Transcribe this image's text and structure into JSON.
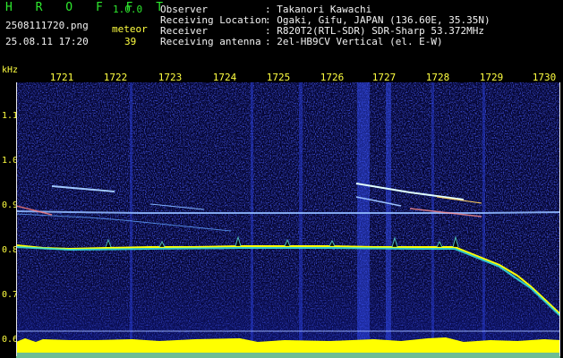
{
  "app": {
    "name": "H R O F F T",
    "version": "1.0.0"
  },
  "file": {
    "name": "2508111720.png",
    "datetime": "25.08.11 17:20"
  },
  "meteor": {
    "label": "meteor",
    "count": "39"
  },
  "info": [
    {
      "key": "Observer",
      "value": ": Takanori Kawachi"
    },
    {
      "key": "Receiving Location",
      "value": ": Ogaki, Gifu, JAPAN (136.60E, 35.35N)"
    },
    {
      "key": "Receiver",
      "value": ": R820T2(RTL-SDR) SDR-Sharp 53.372MHz"
    },
    {
      "key": "Receiving antenna",
      "value": ": 2el-HB9CV Vertical (el. E-W)"
    }
  ],
  "time_axis": [
    "1721",
    "1722",
    "1723",
    "1724",
    "1725",
    "1726",
    "1727",
    "1728",
    "1729",
    "1730"
  ],
  "freq_axis": {
    "unit": "kHz",
    "labels": [
      "1.1",
      "1.0",
      "0.9",
      "0.8",
      "0.7",
      "0.6"
    ]
  },
  "colors": {
    "header_green": "#2ee82e",
    "tick_yellow": "#ffff40",
    "text_white": "#f2f2f2",
    "noise_blue": "#1d2bd8",
    "signal_yellow": "#ffff00",
    "signal_cyan": "#38e8e0"
  }
}
